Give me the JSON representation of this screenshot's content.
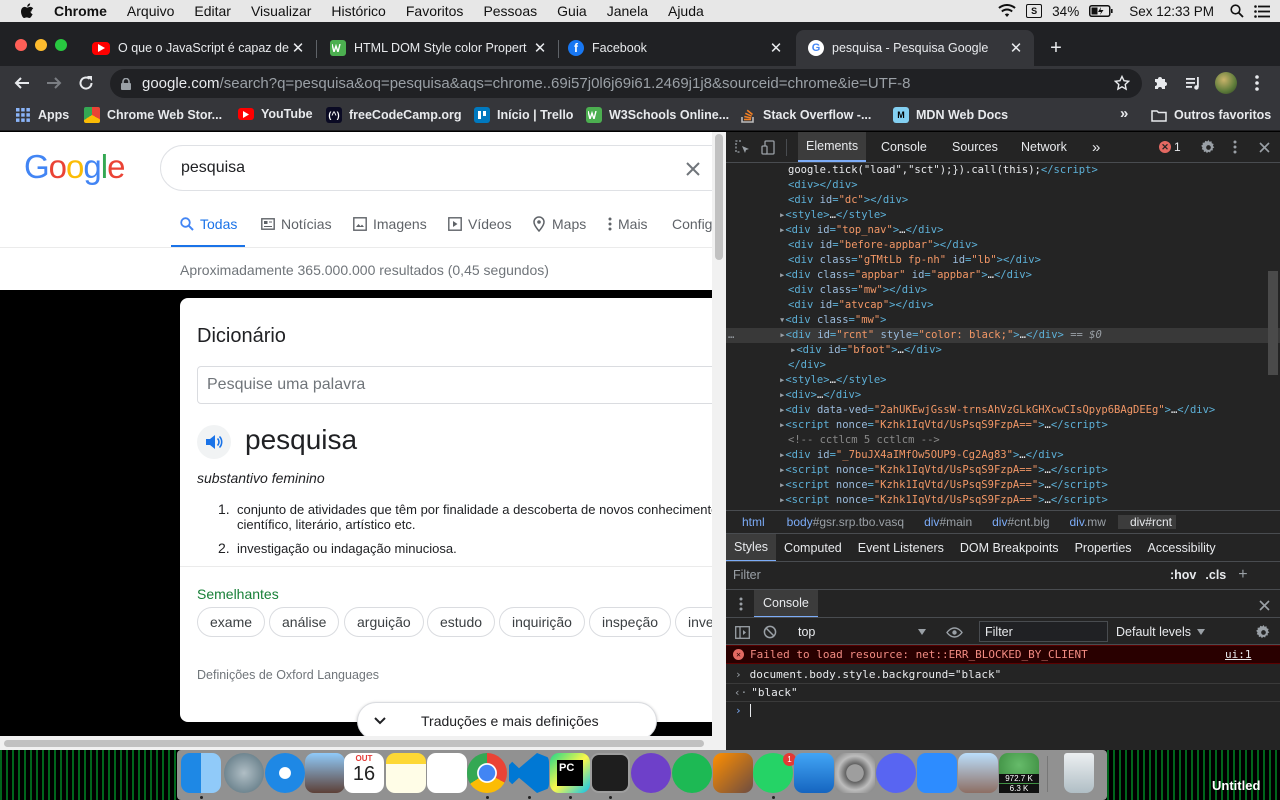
{
  "menubar": {
    "app": "Chrome",
    "items": [
      "Arquivo",
      "Editar",
      "Visualizar",
      "Histórico",
      "Favoritos",
      "Pessoas",
      "Guia",
      "Janela",
      "Ajuda"
    ],
    "battery": "34%",
    "clock": "Sex 12:33 PM"
  },
  "tabs": [
    {
      "title": "O que o JavaScript é capaz de",
      "icon": "youtube-icon",
      "color": "#ff0000"
    },
    {
      "title": "HTML DOM Style color Propert",
      "icon": "w3schools-icon",
      "color": "#4caf50"
    },
    {
      "title": "Facebook",
      "icon": "facebook-icon",
      "color": "#1877f2"
    },
    {
      "title": "pesquisa - Pesquisa Google",
      "icon": "google-icon",
      "color": "#4285f4"
    }
  ],
  "omnibox": {
    "host": "google.com",
    "path": "/search?q=pesquisa&oq=pesquisa&aqs=chrome..69i57j0l6j69i61.2469j1j8&sourceid=chrome&ie=UTF-8"
  },
  "bookmarks": [
    {
      "label": "Apps",
      "icon": "apps-grid-icon",
      "color": "#8ab4f8"
    },
    {
      "label": "Chrome Web Stor...",
      "icon": "chrome-web-store-icon",
      "color": "#e8eaed"
    },
    {
      "label": "YouTube",
      "icon": "youtube-icon",
      "color": "#ff0000"
    },
    {
      "label": "freeCodeCamp.org",
      "icon": "freecodecamp-icon",
      "color": "#0a0a23"
    },
    {
      "label": "Início | Trello",
      "icon": "trello-icon",
      "color": "#0079bf"
    },
    {
      "label": "W3Schools Online...",
      "icon": "w3schools-icon",
      "color": "#4caf50"
    },
    {
      "label": "Stack Overflow -...",
      "icon": "stackoverflow-icon",
      "color": "#f48024"
    },
    {
      "label": "MDN Web Docs",
      "icon": "mdn-icon",
      "color": "#83d0f2"
    }
  ],
  "bookmarks_more": "»",
  "other_bookmarks": "Outros favoritos",
  "google": {
    "logo": "Google",
    "query": "pesquisa",
    "tabs": [
      "Todas",
      "Notícias",
      "Imagens",
      "Vídeos",
      "Maps",
      "Mais",
      "Config"
    ],
    "results_info": "Aproximadamente 365.000.000 resultados (0,45 segundos)"
  },
  "dictionary": {
    "title": "Dicionário",
    "input_placeholder": "Pesquise uma palavra",
    "word": "pesquisa",
    "pos": "substantivo feminino",
    "defs": [
      {
        "n": "1.",
        "line1": "conjunto de atividades que têm por finalidade a descoberta de novos conhecimentos",
        "line2": "científico, literário, artístico etc."
      },
      {
        "n": "2.",
        "line1": "investigação ou indagação minuciosa.",
        "line2": ""
      }
    ],
    "similar_label": "Semelhantes",
    "chips": [
      "exame",
      "análise",
      "arguição",
      "estudo",
      "inquirição",
      "inspeção",
      "investigação"
    ],
    "source": "Definições de Oxford Languages",
    "more_button": "Traduções e mais definições"
  },
  "devtools": {
    "tabs": [
      "Elements",
      "Console",
      "Sources",
      "Network"
    ],
    "more": "»",
    "error_count": "1",
    "crumbs": [
      {
        "tag": "html",
        "rest": ""
      },
      {
        "tag": "body",
        "rest": "#gsr.srp.tbo.vasq"
      },
      {
        "tag": "div",
        "rest": "#main"
      },
      {
        "tag": "div",
        "rest": "#cnt.big"
      },
      {
        "tag": "div",
        "rest": ".mw"
      },
      {
        "tag": "div",
        "rest": "#rcnt"
      }
    ],
    "styles_tabs": [
      "Styles",
      "Computed",
      "Event Listeners",
      "DOM Breakpoints",
      "Properties",
      "Accessibility"
    ],
    "filter_placeholder": "Filter",
    "hov": ":hov",
    "cls": ".cls",
    "console_tab": "Console",
    "context": "top",
    "console_filter": "Filter",
    "levels": "Default levels",
    "console_lines": [
      {
        "kind": "error",
        "text": "Failed to load resource: net::ERR_BLOCKED_BY_CLIENT",
        "link": "ui:1"
      },
      {
        "kind": "input",
        "text": "document.body.style.background=\"black\""
      },
      {
        "kind": "output",
        "text": "\"black\""
      }
    ]
  },
  "dock": {
    "calendar_month": "OUT",
    "calendar_day": "16",
    "net_up": "972.7 K",
    "net_down": "6.3 K",
    "untitled": "Untitled"
  }
}
